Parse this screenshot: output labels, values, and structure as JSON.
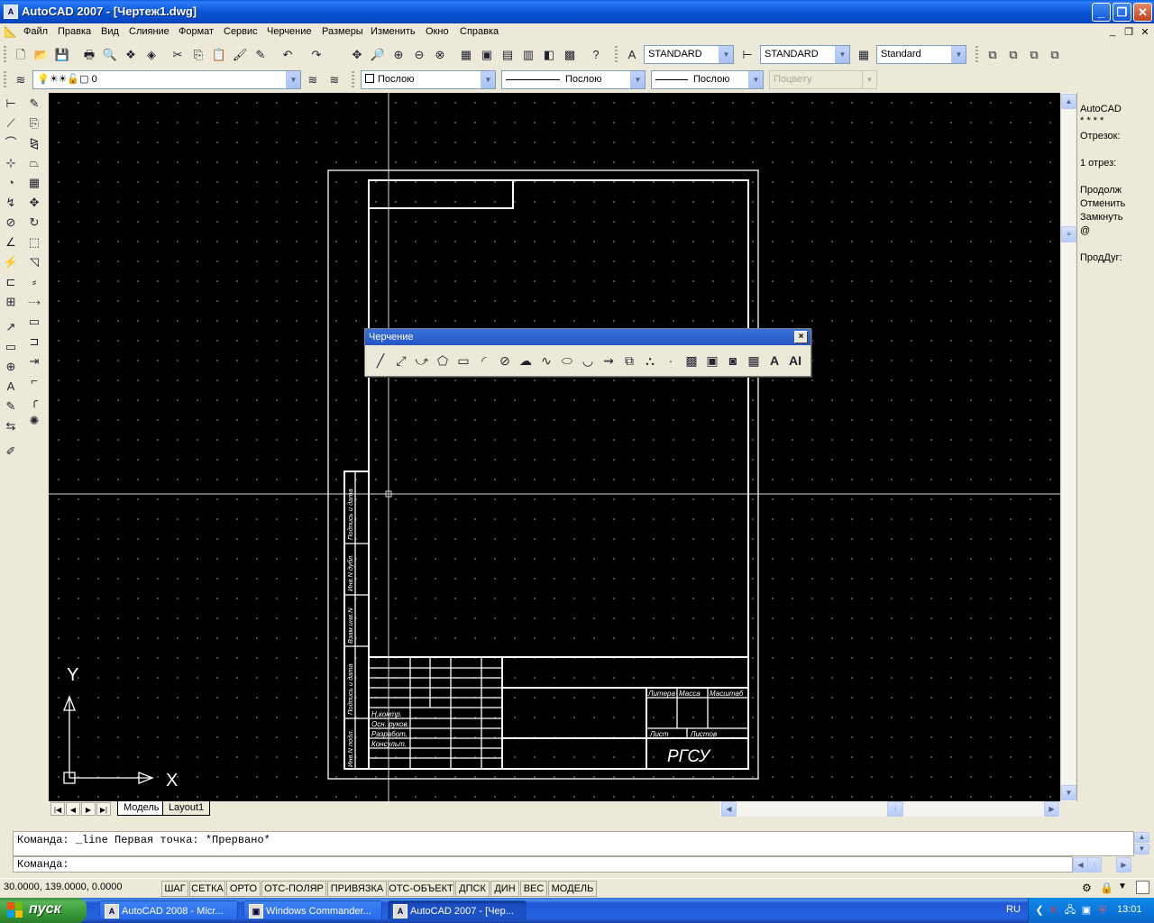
{
  "window": {
    "title": "AutoCAD 2007 - [Чертеж1.dwg]",
    "app_icon_text": "A"
  },
  "menu": [
    "Файл",
    "Правка",
    "Вид",
    "Слияние",
    "Формат",
    "Сервис",
    "Черчение",
    "Размеры",
    "Изменить",
    "Окно",
    "Справка"
  ],
  "toolbar_standard": {
    "text_style": "STANDARD",
    "dim_style": "STANDARD",
    "table_style": "Standard"
  },
  "toolbar_layers": {
    "layer": "0",
    "color": "Послою",
    "linetype": "Послою",
    "lineweight": "Послою",
    "plotstyle": "Поцвету"
  },
  "side_panel": {
    "lines": [
      "AutoCAD",
      "* * * *",
      "Отрезок:",
      "1 отрез:",
      "Продолж",
      "Отменить",
      "Замкнуть",
      "@",
      "ПродДуг:"
    ]
  },
  "drawing": {
    "ucs_x": "X",
    "ucs_y": "Y",
    "title_block_text": "РГСУ",
    "stamp_labels": [
      "Литера",
      "Масса",
      "Масштаб",
      "Лист",
      "Листов"
    ],
    "stamp_rows": [
      "Н.контр.",
      "Осн. руков.",
      "Разработ.",
      "Консульт."
    ],
    "side_strip_labels": [
      "Подпись и дата",
      "Инв.N дубл.",
      "Взам.инв.N",
      "Подпись и дата",
      "Инв.N подл."
    ]
  },
  "floating_toolbar": {
    "title": "Черчение",
    "close": "×"
  },
  "tabs": {
    "model": "Модель",
    "layout": "Layout1"
  },
  "command": {
    "history": "Команда: _line Первая точка: *Прервано*",
    "prompt": "Команда:"
  },
  "status": {
    "coords": "30.0000,  139.0000, 0.0000",
    "buttons": [
      "ШАГ",
      "СЕТКА",
      "ОРТО",
      "ОТС-ПОЛЯР",
      "ПРИВЯЗКА",
      "ОТС-ОБЪЕКТ",
      "ДПСК",
      "ДИН",
      "ВЕС",
      "МОДЕЛЬ"
    ]
  },
  "taskbar": {
    "start": "пуск",
    "tasks": [
      "AutoCAD 2008 - Micr...",
      "Windows Commander...",
      "AutoCAD 2007 - [Чер..."
    ],
    "lang": "RU",
    "clock": "13:01"
  }
}
